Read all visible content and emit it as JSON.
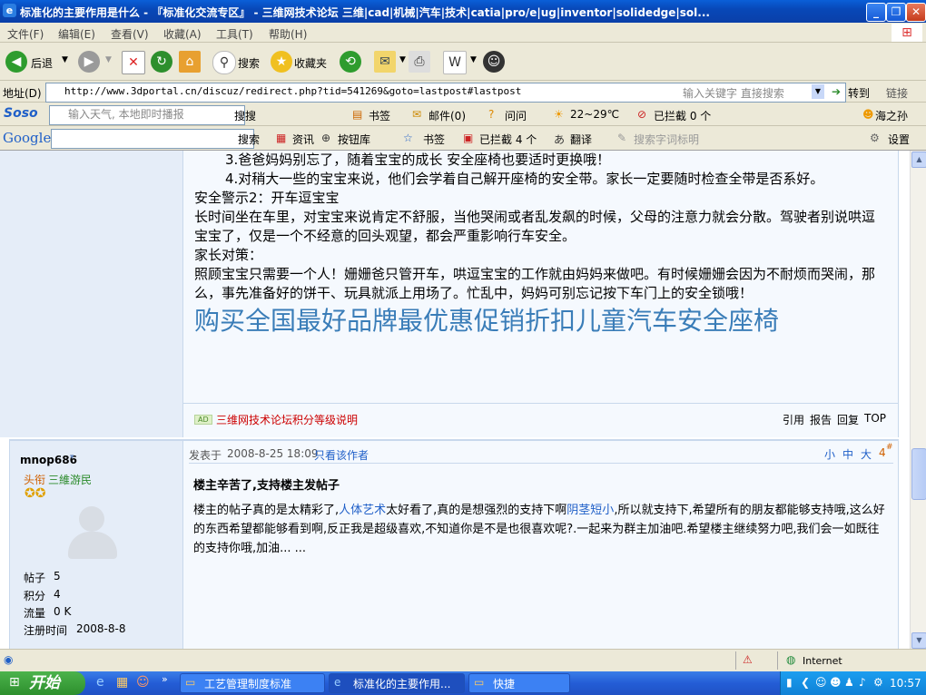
{
  "window": {
    "title": "标准化的主要作用是什么 - 『标准化交流专区』 - 三维网技术论坛 三维|cad|机械|汽车|技术|catia|pro/e|ug|inventor|solidedge|sol...",
    "minimize": "_",
    "maximize": "❐",
    "close": "✕"
  },
  "menu": [
    "文件(F)",
    "编辑(E)",
    "查看(V)",
    "收藏(A)",
    "工具(T)",
    "帮助(H)"
  ],
  "toolbar": {
    "back": "后退",
    "search": "搜索",
    "favorites": "收藏夹"
  },
  "address": {
    "label": "地址(D)",
    "url": "http://www.3dportal.cn/discuz/redirect.php?tid=541269&goto=lastpost#lastpost",
    "hint": "输入关键字 直接搜索",
    "go": "转到",
    "links": "链接"
  },
  "soso": {
    "brand": "Soso",
    "placeholder": "输入天气, 本地即时播报",
    "search": "搜搜",
    "bookmarks": "书签",
    "mail": "邮件(0)",
    "ask": "问问",
    "weather": "22~29℃",
    "blocked": "已拦截 0 个",
    "user": "海之孙"
  },
  "google": {
    "brand": "Google",
    "search": "搜索",
    "news": "资讯",
    "buttons": "按钮库",
    "bookmarks": "书签",
    "blocked": "已拦截 4 个",
    "translate": "翻译",
    "highlight": "搜索字词标明",
    "settings": "设置"
  },
  "post1": {
    "lines": [
      "3.爸爸妈妈别忘了，随着宝宝的成长 安全座椅也要适时更换哦！",
      "4.对稍大一些的宝宝来说，他们会学着自己解开座椅的安全带。家长一定要随时检查全带是否系好。",
      "安全警示2：开车逗宝宝",
      "长时间坐在车里，对宝宝来说肯定不舒服，当他哭闹或者乱发飙的时候，父母的注意力就会分散。驾驶者别说哄逗宝宝了，仅是一个不经意的回头观望，都会严重影响行车安全。",
      "家长对策：",
      "照顾宝宝只需要一个人！姗姗爸只管开车，哄逗宝宝的工作就由妈妈来做吧。有时候姗姗会因为不耐烦而哭闹，那么，事先准备好的饼干、玩具就派上用场了。忙乱中，妈妈可别忘记按下车门上的安全锁哦！"
    ],
    "promo": "购买全国最好品牌最优惠促销折扣儿童汽车安全座椅",
    "ad_badge": "AD",
    "ad_link": "三维网技术论坛积分等级说明",
    "actions": [
      "引用",
      "报告",
      "回复",
      "TOP"
    ]
  },
  "post2": {
    "author": "mnop686",
    "rank_label": "头衔",
    "rank": "三維游民",
    "stats": [
      {
        "k": "帖子",
        "v": "5"
      },
      {
        "k": "积分",
        "v": "4"
      },
      {
        "k": "流量",
        "v": "0 K"
      },
      {
        "k": "注册时间",
        "v": "2008-8-8"
      }
    ],
    "posted_label": "发表于",
    "posted": "2008-8-25 18:09",
    "only_author": "只看该作者",
    "sizes": [
      "小",
      "中",
      "大"
    ],
    "floor": "4",
    "floor_sup": "#",
    "title": "楼主辛苦了,支持楼主发帖子",
    "body_a": "楼主的帖子真的是太精彩了,",
    "link1": "人体艺术",
    "body_b": "太好看了,真的是想强烈的支持下啊",
    "link2": "阴茎短小",
    "body_c": ",所以就支持下,希望所有的朋友都能够支持哦,这么好的东西希望都能够看到啊,反正我是超级喜欢,不知道你是不是也很喜欢呢?.一起来为群主加油吧.希望楼主继续努力吧,我们会一如既往的支持你哦,加油... ..."
  },
  "status": {
    "zone": "Internet"
  },
  "taskbar": {
    "start": "开始",
    "tasks": [
      "工艺管理制度标准",
      "标准化的主要作用...",
      "快捷"
    ],
    "clock": "10:57"
  }
}
